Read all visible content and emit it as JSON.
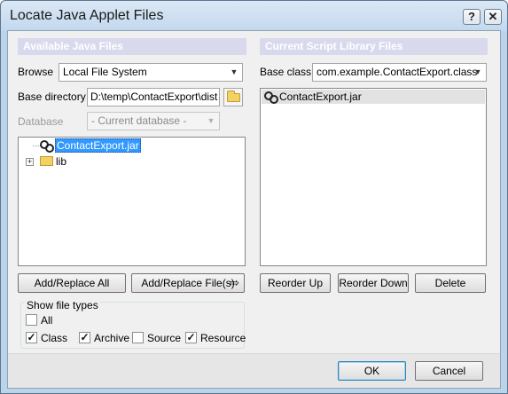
{
  "window": {
    "title": "Locate Java Applet Files",
    "help_label": "?",
    "close_label": "✕"
  },
  "left": {
    "header": "Available Java Files",
    "browse": {
      "label": "Browse",
      "value": "Local File System"
    },
    "base_directory": {
      "label": "Base directory",
      "value": "D:\\temp\\ContactExport\\dist"
    },
    "database": {
      "label": "Database",
      "value": "- Current database -"
    },
    "tree": [
      {
        "label": "ContactExport.jar",
        "icon": "jar-icon",
        "selected": true
      },
      {
        "label": "lib",
        "icon": "folder-icon",
        "expander": "+"
      }
    ],
    "buttons": {
      "add_replace_all": "Add/Replace All",
      "add_replace_files": "Add/Replace File(s)",
      "arrow": "⇨"
    }
  },
  "right": {
    "header": "Current Script Library Files",
    "base_class": {
      "label": "Base class",
      "value": "com.example.ContactExport.class"
    },
    "list": [
      {
        "label": "ContactExport.jar",
        "icon": "jar-icon"
      }
    ],
    "buttons": {
      "reorder_up": "Reorder Up",
      "reorder_down": "Reorder Down",
      "delete": "Delete"
    }
  },
  "file_types": {
    "label": "Show file types",
    "all": {
      "label": "All",
      "checked": false
    },
    "class": {
      "label": "Class",
      "checked": true
    },
    "archive": {
      "label": "Archive",
      "checked": true
    },
    "source": {
      "label": "Source",
      "checked": false
    },
    "resource": {
      "label": "Resource",
      "checked": true
    }
  },
  "footer": {
    "ok": "OK",
    "cancel": "Cancel"
  },
  "check_mark": "✓",
  "dropdown_arrow": "▼",
  "colors": {
    "section_header_bg": "#d9d9ee",
    "selection": "#3399ff",
    "title_bar": "#c3d8ee"
  }
}
